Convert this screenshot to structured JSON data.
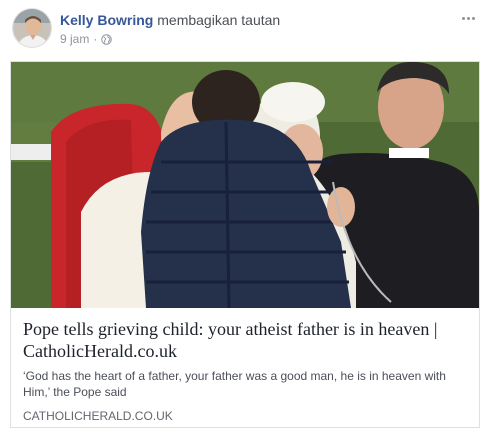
{
  "post": {
    "author": "Kelly Bowring",
    "action": "membagikan tautan",
    "time": "9 jam",
    "separator": "·",
    "privacy_icon": "globe-icon",
    "more_icon": "more-options-icon"
  },
  "link_card": {
    "title": "Pope tells grieving child: your atheist father is in heaven | CatholicHerald.co.uk",
    "description": "‘God has the heart of a father, your father was a good man, he is in heaven with Him,’ the Pope said",
    "domain": "CATHOLICHERALD.CO.UK"
  },
  "colors": {
    "author_link": "#365899",
    "meta_text": "#90949c",
    "border": "#dddfe2"
  }
}
